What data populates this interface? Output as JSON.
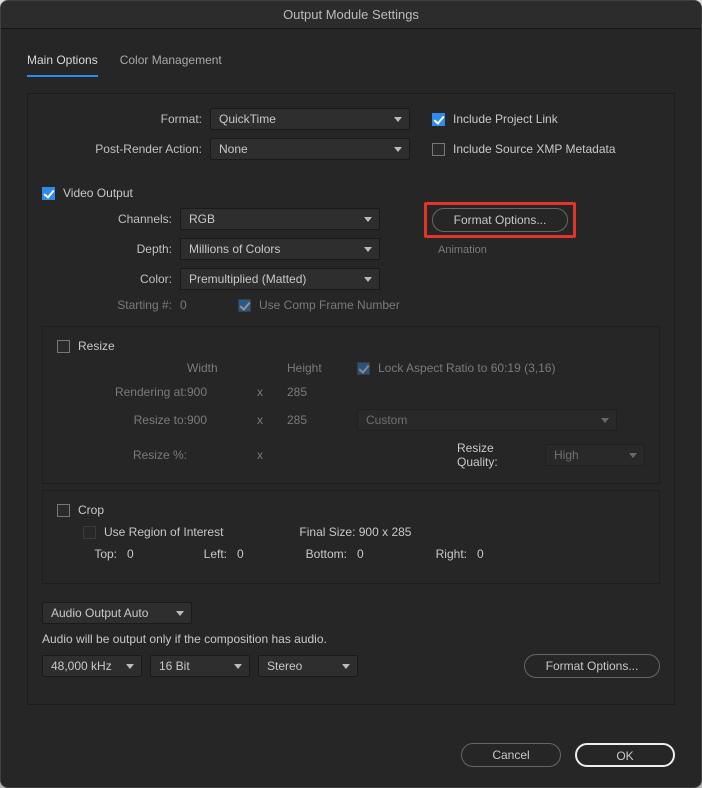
{
  "title": "Output Module Settings",
  "tabs": {
    "main": "Main Options",
    "cm": "Color Management"
  },
  "format": {
    "label": "Format:",
    "value": "QuickTime"
  },
  "post": {
    "label": "Post-Render Action:",
    "value": "None"
  },
  "incProj": {
    "label": "Include Project Link",
    "checked": true
  },
  "incXmp": {
    "label": "Include Source XMP Metadata",
    "checked": false
  },
  "video": {
    "title": "Video Output",
    "checked": true,
    "channels": {
      "label": "Channels:",
      "value": "RGB"
    },
    "depth": {
      "label": "Depth:",
      "value": "Millions of Colors"
    },
    "color": {
      "label": "Color:",
      "value": "Premultiplied (Matted)"
    },
    "starting": {
      "label": "Starting #:",
      "value": "0"
    },
    "useComp": {
      "label": "Use Comp Frame Number",
      "checked": true
    },
    "formatOpts": "Format Options...",
    "codec": "Animation"
  },
  "resize": {
    "title": "Resize",
    "checked": false,
    "width": "Width",
    "height": "Height",
    "lock": {
      "label": "Lock Aspect Ratio to 60:19 (3,16)",
      "checked": true
    },
    "rendering": {
      "label": "Rendering at:",
      "w": "900",
      "h": "285"
    },
    "resizeTo": {
      "label": "Resize to:",
      "w": "900",
      "h": "285",
      "preset": "Custom"
    },
    "resizePct": {
      "label": "Resize %:",
      "quality": "Resize Quality:",
      "value": "High"
    }
  },
  "crop": {
    "title": "Crop",
    "checked": false,
    "roi": {
      "label": "Use Region of Interest",
      "checked": false
    },
    "final": "Final Size: 900 x 285",
    "top": "Top:",
    "left": "Left:",
    "bottom": "Bottom:",
    "right": "Right:",
    "v": "0"
  },
  "audio": {
    "mode": "Audio Output Auto",
    "note": "Audio will be output only if the composition has audio.",
    "rate": "48,000 kHz",
    "bit": "16 Bit",
    "ch": "Stereo",
    "formatOpts": "Format Options..."
  },
  "buttons": {
    "cancel": "Cancel",
    "ok": "OK"
  }
}
